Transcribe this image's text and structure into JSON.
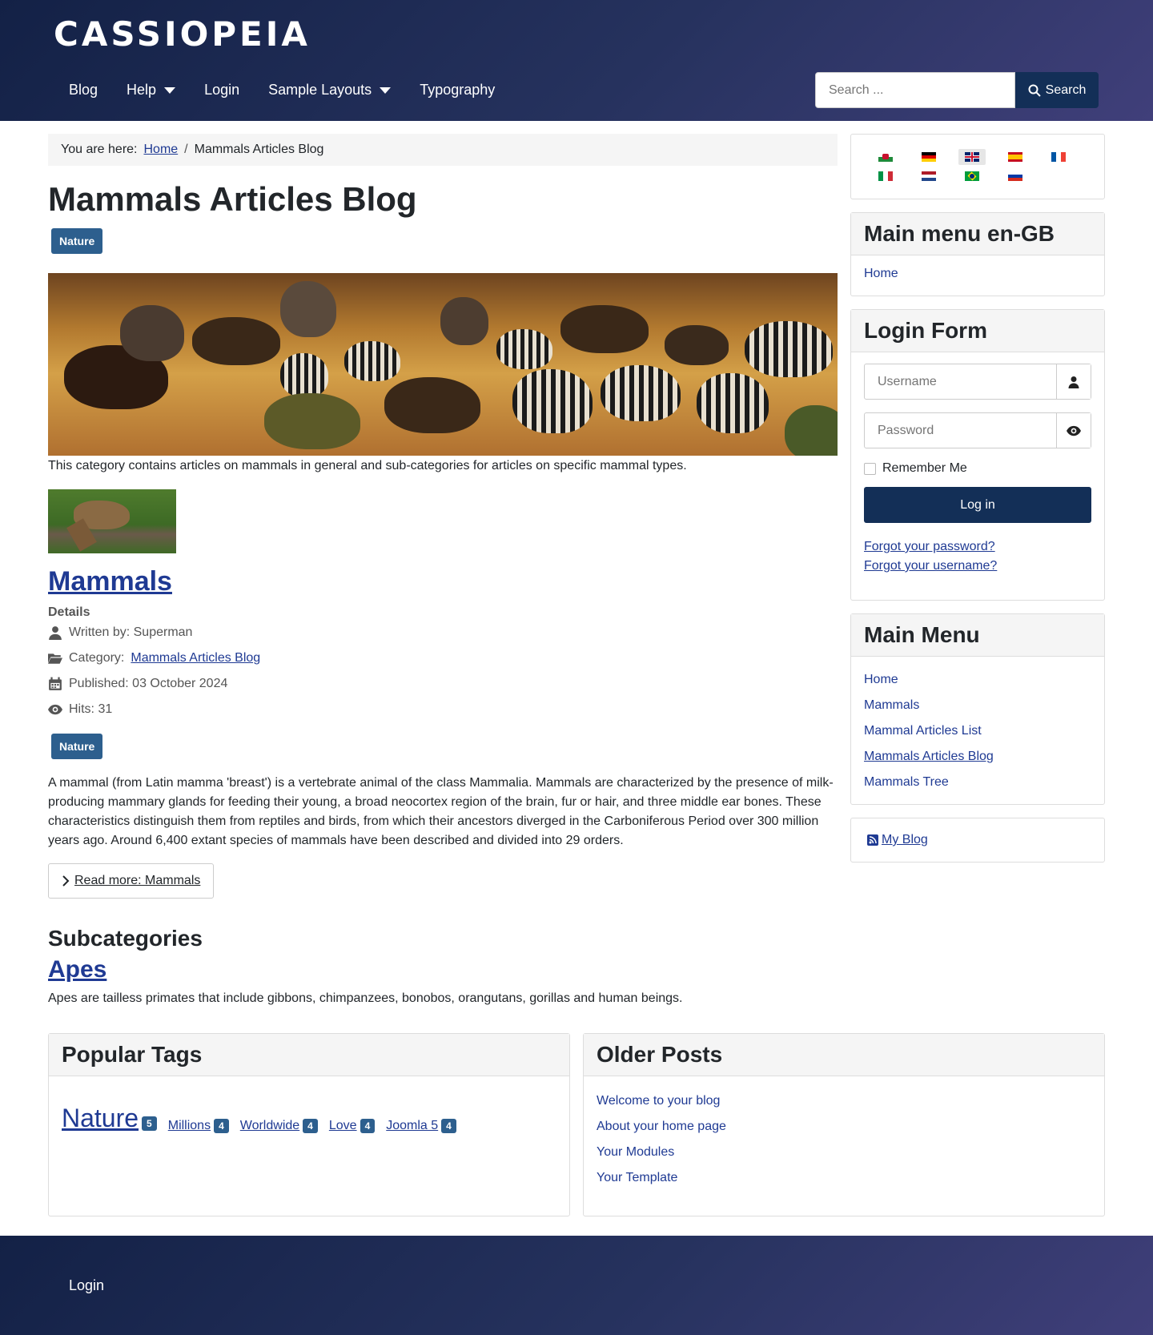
{
  "header": {
    "brand": "CASSIOPEIA",
    "nav": [
      {
        "label": "Blog",
        "dropdown": false
      },
      {
        "label": "Help",
        "dropdown": true
      },
      {
        "label": "Login",
        "dropdown": false
      },
      {
        "label": "Sample Layouts",
        "dropdown": true
      },
      {
        "label": "Typography",
        "dropdown": false
      }
    ],
    "search_placeholder": "Search ...",
    "search_button": "Search"
  },
  "breadcrumb": {
    "prefix": "You are here:",
    "home": "Home",
    "current": "Mammals Articles Blog"
  },
  "main": {
    "title": "Mammals Articles Blog",
    "tag": "Nature",
    "category_description": "This category contains articles on mammals in general and sub-categories for articles on specific mammal types.",
    "article": {
      "title": "Mammals",
      "details_label": "Details",
      "written_by": "Written by: Superman",
      "category_prefix": "Category:",
      "category_link": "Mammals Articles Blog",
      "published": "Published: 03 October 2024",
      "hits": "Hits: 31",
      "tag": "Nature",
      "intro": "A mammal (from Latin mamma 'breast') is a vertebrate animal of the class Mammalia. Mammals are characterized by the presence of milk-producing mammary glands for feeding their young, a broad neocortex region of the brain, fur or hair, and three middle ear bones. These characteristics distinguish them from reptiles and birds, from which their ancestors diverged in the Carboniferous Period over 300 million years ago. Around 6,400 extant species of mammals have been described and divided into 29 orders.",
      "read_more": "Read more: Mammals"
    },
    "subcategories": {
      "heading": "Subcategories",
      "items": [
        {
          "title": "Apes",
          "description": "Apes are tailless primates that include gibbons, chimpanzees, bonobos, orangutans, gorillas and human beings."
        }
      ]
    }
  },
  "sidebar": {
    "languages": [
      {
        "code": "cy",
        "active": false
      },
      {
        "code": "de",
        "active": false
      },
      {
        "code": "en-GB",
        "active": true
      },
      {
        "code": "es",
        "active": false
      },
      {
        "code": "fr",
        "active": false
      },
      {
        "code": "it",
        "active": false
      },
      {
        "code": "nl",
        "active": false
      },
      {
        "code": "pt-BR",
        "active": false
      },
      {
        "code": "ru",
        "active": false
      }
    ],
    "main_menu_en": {
      "title": "Main menu en-GB",
      "items": [
        "Home"
      ]
    },
    "login_form": {
      "title": "Login Form",
      "username_placeholder": "Username",
      "password_placeholder": "Password",
      "remember": "Remember Me",
      "button": "Log in",
      "forgot_password": "Forgot your password?",
      "forgot_username": "Forgot your username?"
    },
    "main_menu": {
      "title": "Main Menu",
      "items": [
        "Home",
        "Mammals",
        "Mammal Articles List",
        "Mammals Articles Blog",
        "Mammals Tree"
      ]
    },
    "feed_link": "My Blog"
  },
  "bottom": {
    "popular_tags": {
      "title": "Popular Tags",
      "tags": [
        {
          "label": "Nature",
          "count": "5"
        },
        {
          "label": "Millions",
          "count": "4"
        },
        {
          "label": "Worldwide",
          "count": "4"
        },
        {
          "label": "Love",
          "count": "4"
        },
        {
          "label": "Joomla 5",
          "count": "4"
        }
      ]
    },
    "older_posts": {
      "title": "Older Posts",
      "items": [
        "Welcome to your blog",
        "About your home page",
        "Your Modules",
        "Your Template"
      ]
    }
  },
  "footer": {
    "link": "Login"
  },
  "colors": {
    "header_start": "#132146",
    "header_end": "#403f7a",
    "button": "#132f57",
    "tag_badge": "#2d5f8e",
    "link": "#1f3a93"
  }
}
